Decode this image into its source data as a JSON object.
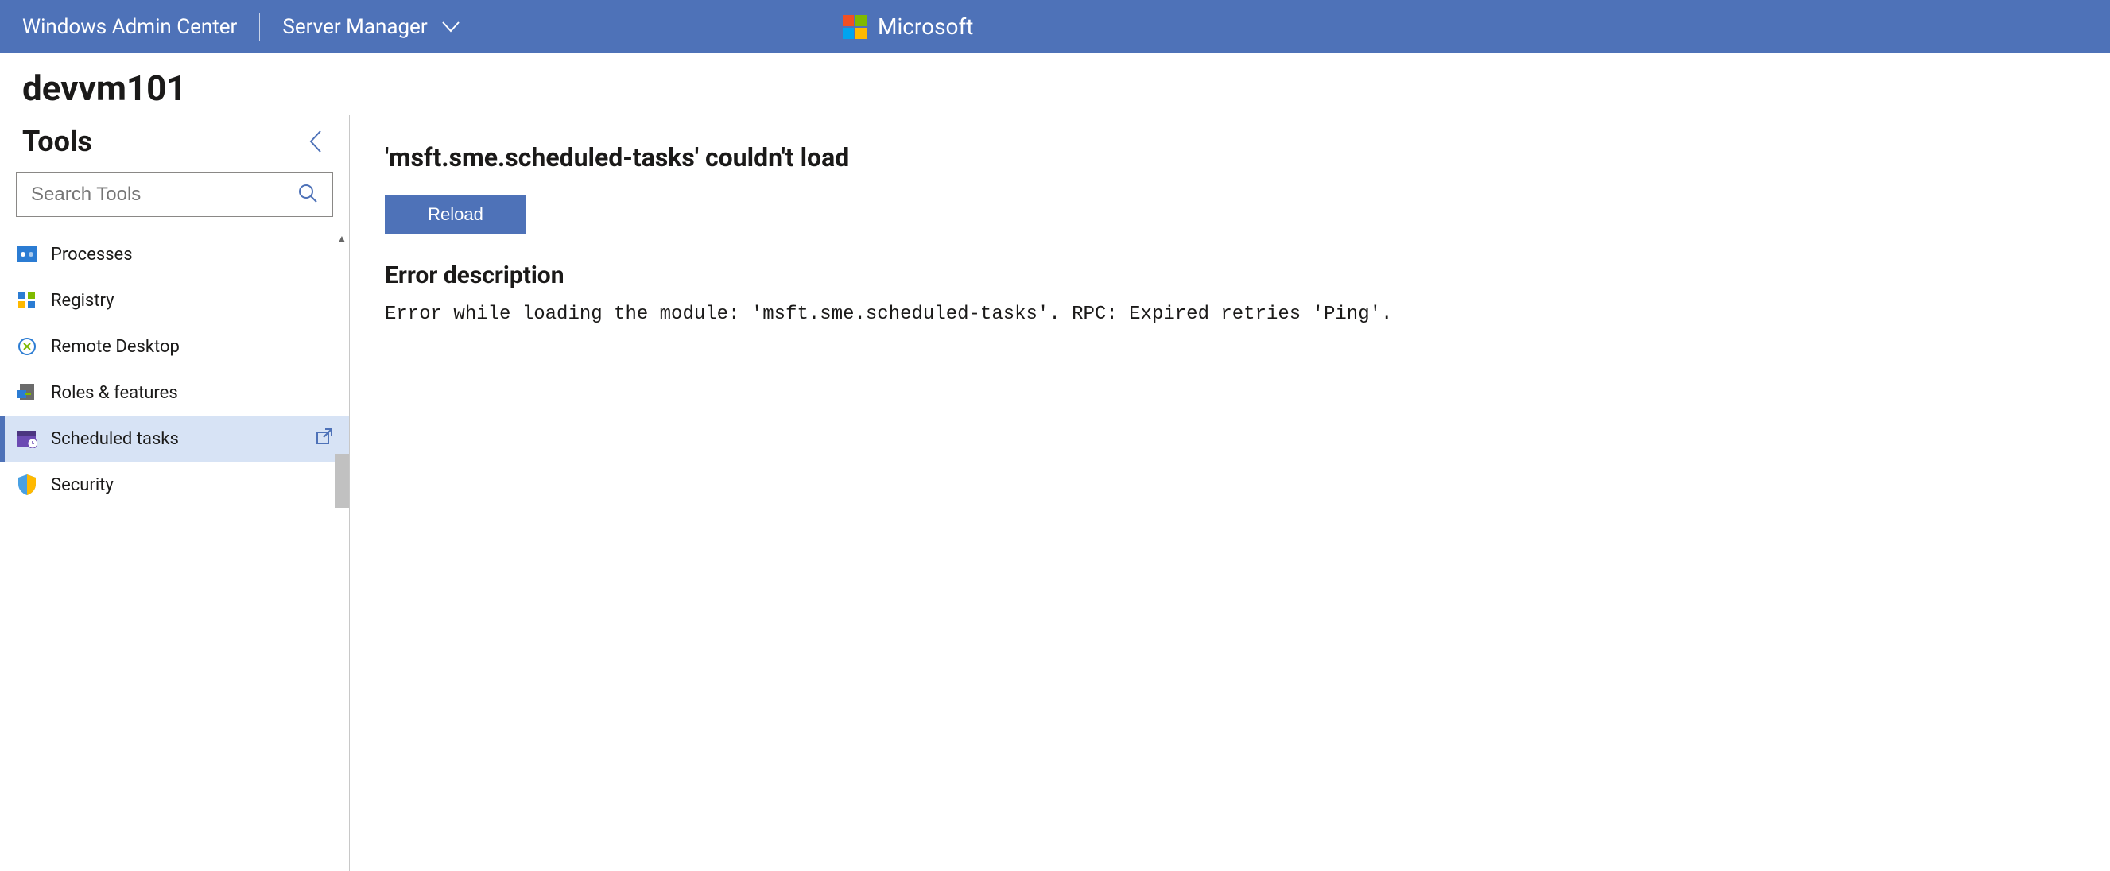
{
  "topbar": {
    "product": "Windows Admin Center",
    "context": "Server Manager",
    "brand": "Microsoft"
  },
  "page": {
    "server_name": "devvm101"
  },
  "sidebar": {
    "title": "Tools",
    "search_placeholder": "Search Tools",
    "items": [
      {
        "label": "Processes"
      },
      {
        "label": "Registry"
      },
      {
        "label": "Remote Desktop"
      },
      {
        "label": "Roles & features"
      },
      {
        "label": "Scheduled tasks"
      },
      {
        "label": "Security"
      }
    ]
  },
  "main": {
    "error_title": "'msft.sme.scheduled-tasks' couldn't load",
    "reload_label": "Reload",
    "error_subtitle": "Error description",
    "error_body": "Error while loading the module: 'msft.sme.scheduled-tasks'. RPC: Expired retries 'Ping'."
  }
}
